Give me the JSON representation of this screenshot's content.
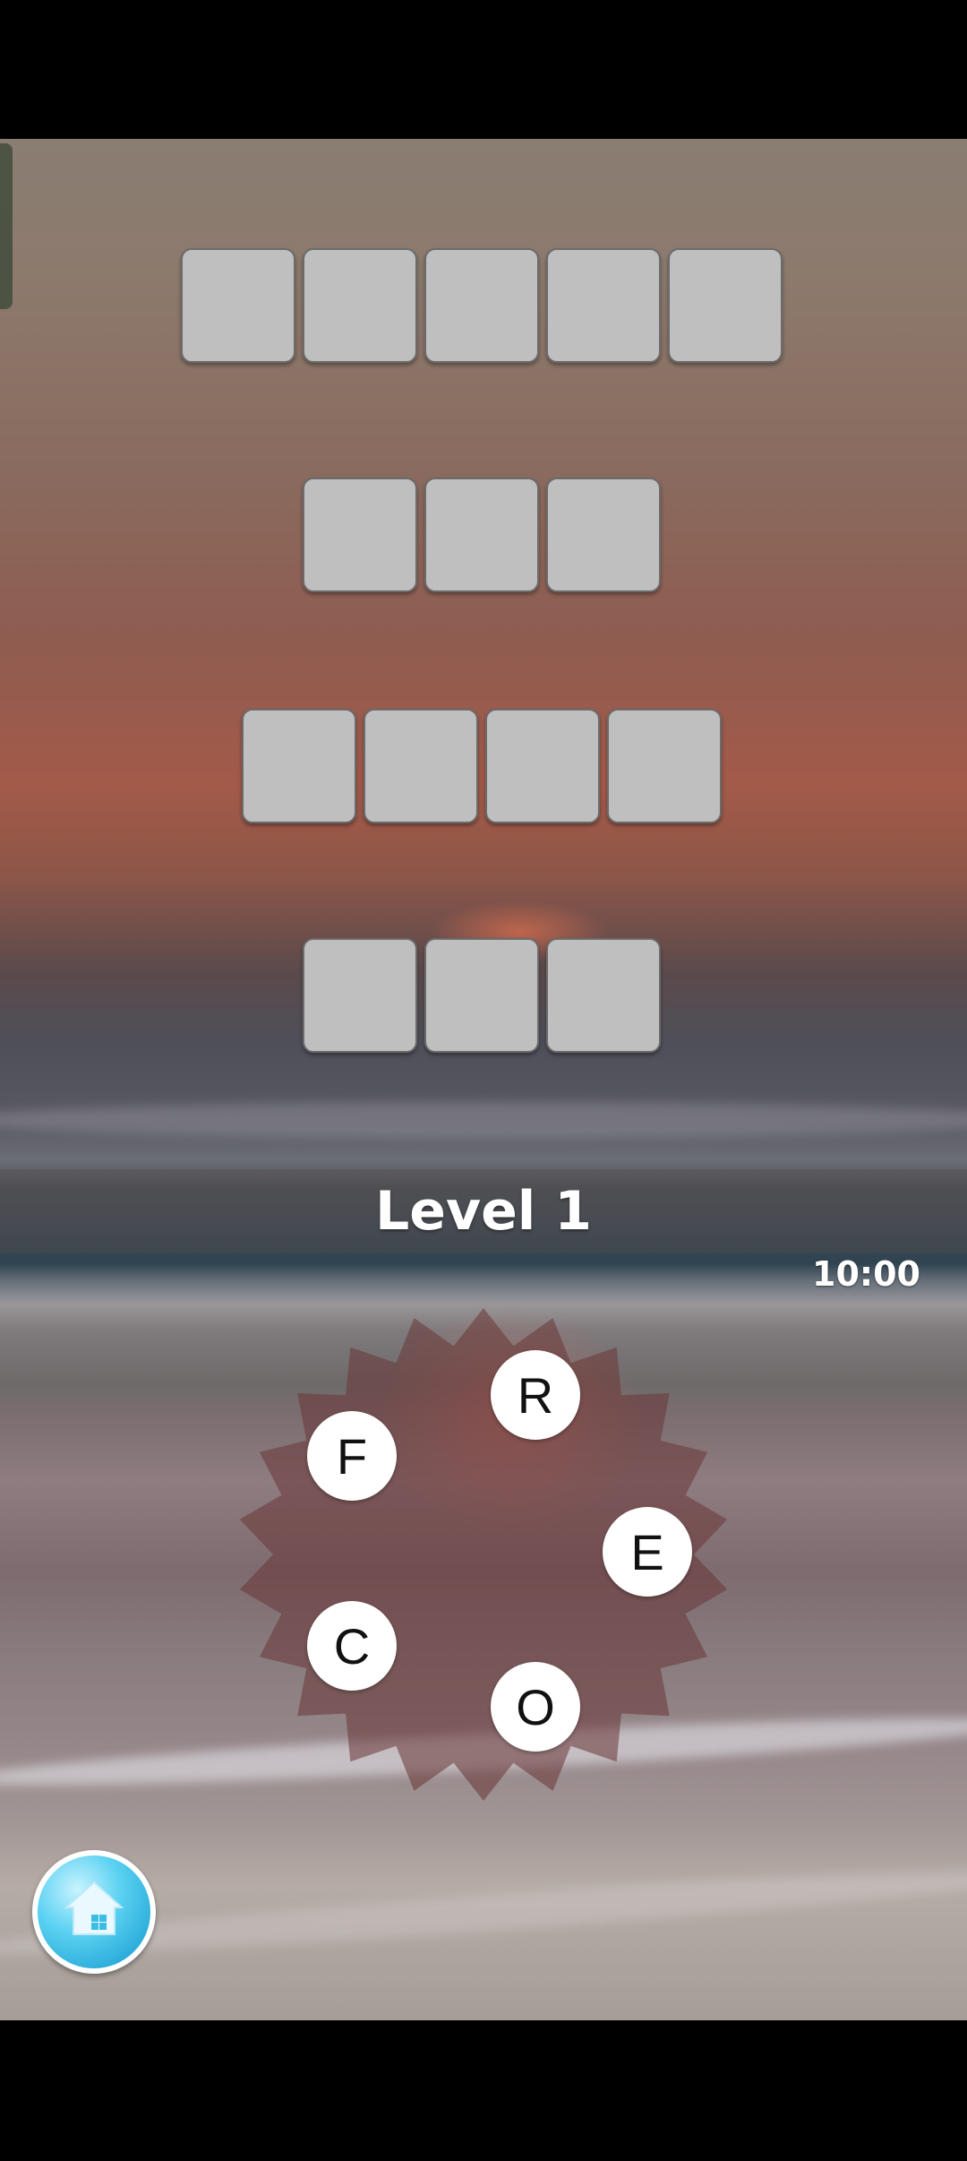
{
  "game": {
    "level_title": "Level 1",
    "timer": "10:00"
  },
  "board": {
    "rows": [
      {
        "word_length": 5
      },
      {
        "word_length": 3
      },
      {
        "word_length": 4
      },
      {
        "word_length": 3
      }
    ]
  },
  "wheel": {
    "letters": [
      "R",
      "F",
      "E",
      "C",
      "O"
    ]
  },
  "icons": {
    "home_button": "home-icon"
  },
  "colors": {
    "tile": "#c0bfbf",
    "home_button": "#4cc7ee"
  }
}
